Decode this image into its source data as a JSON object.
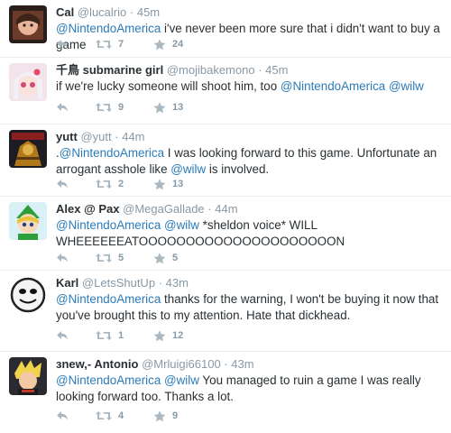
{
  "tweets": [
    {
      "name": "Cal",
      "handle": "@lucalrio",
      "sep": "·",
      "time": "45m",
      "text_parts": [
        {
          "t": "@NintendoAmerica",
          "m": true
        },
        {
          "t": " i've never been more sure that i didn't want to buy a game",
          "m": false
        }
      ],
      "retweets": "7",
      "favorites": "24"
    },
    {
      "name": "千鳥 submarine girl",
      "handle": "@mojibakemono",
      "sep": "·",
      "time": "45m",
      "text_parts": [
        {
          "t": "if we're lucky someone will shoot him, too ",
          "m": false
        },
        {
          "t": "@NintendoAmerica",
          "m": true
        },
        {
          "t": " ",
          "m": false
        },
        {
          "t": "@wilw",
          "m": true
        }
      ],
      "retweets": "9",
      "favorites": "13"
    },
    {
      "name": "yutt",
      "handle": "@yutt",
      "sep": "·",
      "time": "44m",
      "text_parts": [
        {
          "t": ".",
          "m": false
        },
        {
          "t": "@NintendoAmerica",
          "m": true
        },
        {
          "t": " I was looking forward to this game. Unfortunate an arrogant asshole like ",
          "m": false
        },
        {
          "t": "@wilw",
          "m": true
        },
        {
          "t": " is involved.",
          "m": false
        }
      ],
      "retweets": "2",
      "favorites": "13"
    },
    {
      "name": "Alex @ Pax",
      "handle": "@MegaGallade",
      "sep": "·",
      "time": "44m",
      "text_parts": [
        {
          "t": "@NintendoAmerica",
          "m": true
        },
        {
          "t": " ",
          "m": false
        },
        {
          "t": "@wilw",
          "m": true
        },
        {
          "t": " *sheldon voice* WILL WHEEEEEEATOOOOOOOOOOOOOOOOOOOOON",
          "m": false
        }
      ],
      "retweets": "5",
      "favorites": "5"
    },
    {
      "name": "Karl",
      "handle": "@LetsShutUp",
      "sep": "·",
      "time": "43m",
      "text_parts": [
        {
          "t": "@NintendoAmerica",
          "m": true
        },
        {
          "t": " thanks for the warning, I won't be buying it now that you've brought this to my attention. Hate that dickhead.",
          "m": false
        }
      ],
      "retweets": "1",
      "favorites": "12"
    },
    {
      "name": "ɜnew,- Antonio",
      "handle": "@Mrluigi66100",
      "sep": "·",
      "time": "43m",
      "text_parts": [
        {
          "t": "@NintendoAmerica",
          "m": true
        },
        {
          "t": " ",
          "m": false
        },
        {
          "t": "@wilw",
          "m": true
        },
        {
          "t": " You managed to ruin a game I was really looking forward too. Thanks a lot.",
          "m": false
        }
      ],
      "retweets": "4",
      "favorites": "9"
    }
  ],
  "colors": {
    "mention": "#2b7bb9",
    "meta": "#8899a6",
    "text": "#292f33",
    "divider": "#e6ecf0"
  },
  "icons": {
    "reply": "reply-icon",
    "retweet": "retweet-icon",
    "favorite": "star-icon"
  }
}
